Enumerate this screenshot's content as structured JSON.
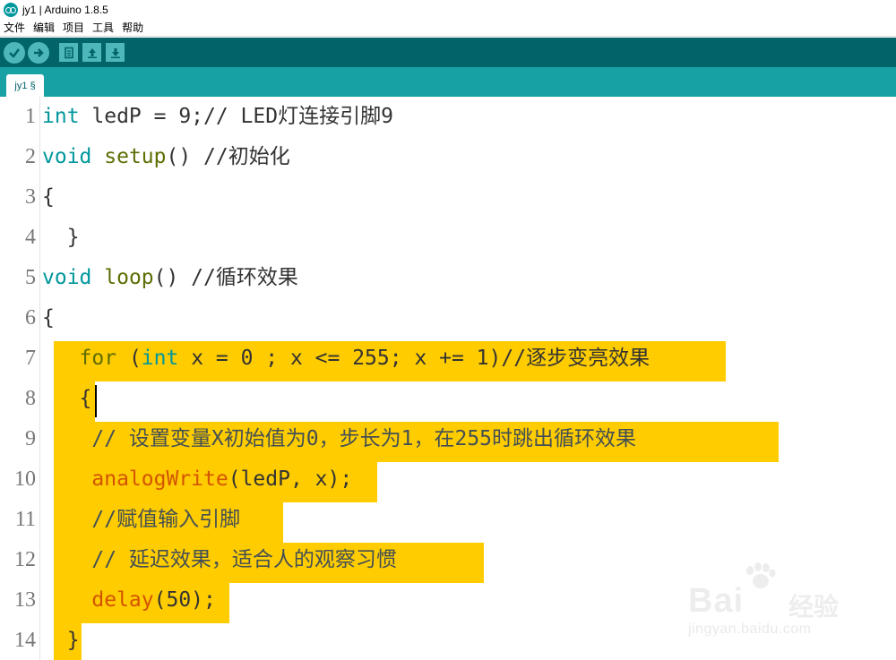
{
  "window": {
    "title": "jy1 | Arduino 1.8.5"
  },
  "menu": [
    "文件",
    "编辑",
    "项目",
    "工具",
    "帮助"
  ],
  "toolbar": {
    "buttons": [
      "verify-icon",
      "upload-icon",
      "new-icon",
      "open-icon",
      "save-icon"
    ]
  },
  "tabs": [
    {
      "label": "jy1 §"
    }
  ],
  "editor": {
    "highlight_color": "#ffcc00",
    "lines": [
      {
        "num": "1",
        "parts": [
          {
            "t": "int",
            "c": "kw-type"
          },
          {
            "t": " ledP = 9;// LED灯连接引脚9",
            "c": ""
          }
        ]
      },
      {
        "num": "2",
        "parts": [
          {
            "t": "void",
            "c": "kw-type"
          },
          {
            "t": " ",
            "c": ""
          },
          {
            "t": "setup",
            "c": "kw-ctl"
          },
          {
            "t": "() //初始化",
            "c": ""
          }
        ]
      },
      {
        "num": "3",
        "parts": [
          {
            "t": "{",
            "c": ""
          }
        ]
      },
      {
        "num": "4",
        "parts": [
          {
            "t": "  }",
            "c": ""
          }
        ]
      },
      {
        "num": "5",
        "parts": [
          {
            "t": "void",
            "c": "kw-type"
          },
          {
            "t": " ",
            "c": ""
          },
          {
            "t": "loop",
            "c": "kw-ctl"
          },
          {
            "t": "() //循环效果",
            "c": ""
          }
        ]
      },
      {
        "num": "6",
        "parts": [
          {
            "t": "{",
            "c": ""
          }
        ]
      },
      {
        "num": "7",
        "parts": [
          {
            "t": "   ",
            "c": ""
          },
          {
            "t": "for",
            "c": "kw-ctl"
          },
          {
            "t": " (",
            "c": ""
          },
          {
            "t": "int",
            "c": "kw-type"
          },
          {
            "t": " x = 0 ; x <= 255; x += 1)//逐步变亮效果",
            "c": ""
          }
        ]
      },
      {
        "num": "8",
        "parts": [
          {
            "t": "   {",
            "c": ""
          }
        ]
      },
      {
        "num": "9",
        "parts": [
          {
            "t": "    // 设置变量X初始值为0，步长为1，在255时跳出循环效果",
            "c": "cmt"
          }
        ]
      },
      {
        "num": "10",
        "parts": [
          {
            "t": "    ",
            "c": ""
          },
          {
            "t": "analogWrite",
            "c": "kw-fn"
          },
          {
            "t": "(ledP, x);",
            "c": ""
          }
        ]
      },
      {
        "num": "11",
        "parts": [
          {
            "t": "    //赋值输入引脚",
            "c": "cmt"
          }
        ]
      },
      {
        "num": "12",
        "parts": [
          {
            "t": "    // 延迟效果，适合人的观察习惯",
            "c": "cmt"
          }
        ]
      },
      {
        "num": "13",
        "parts": [
          {
            "t": "    ",
            "c": ""
          },
          {
            "t": "delay",
            "c": "kw-fn"
          },
          {
            "t": "(50);",
            "c": ""
          }
        ]
      },
      {
        "num": "14",
        "parts": [
          {
            "t": "  }",
            "c": ""
          }
        ]
      }
    ]
  },
  "watermark": {
    "brand": "Bai",
    "brand2": "经验",
    "url": "jingyan.baidu.com"
  }
}
